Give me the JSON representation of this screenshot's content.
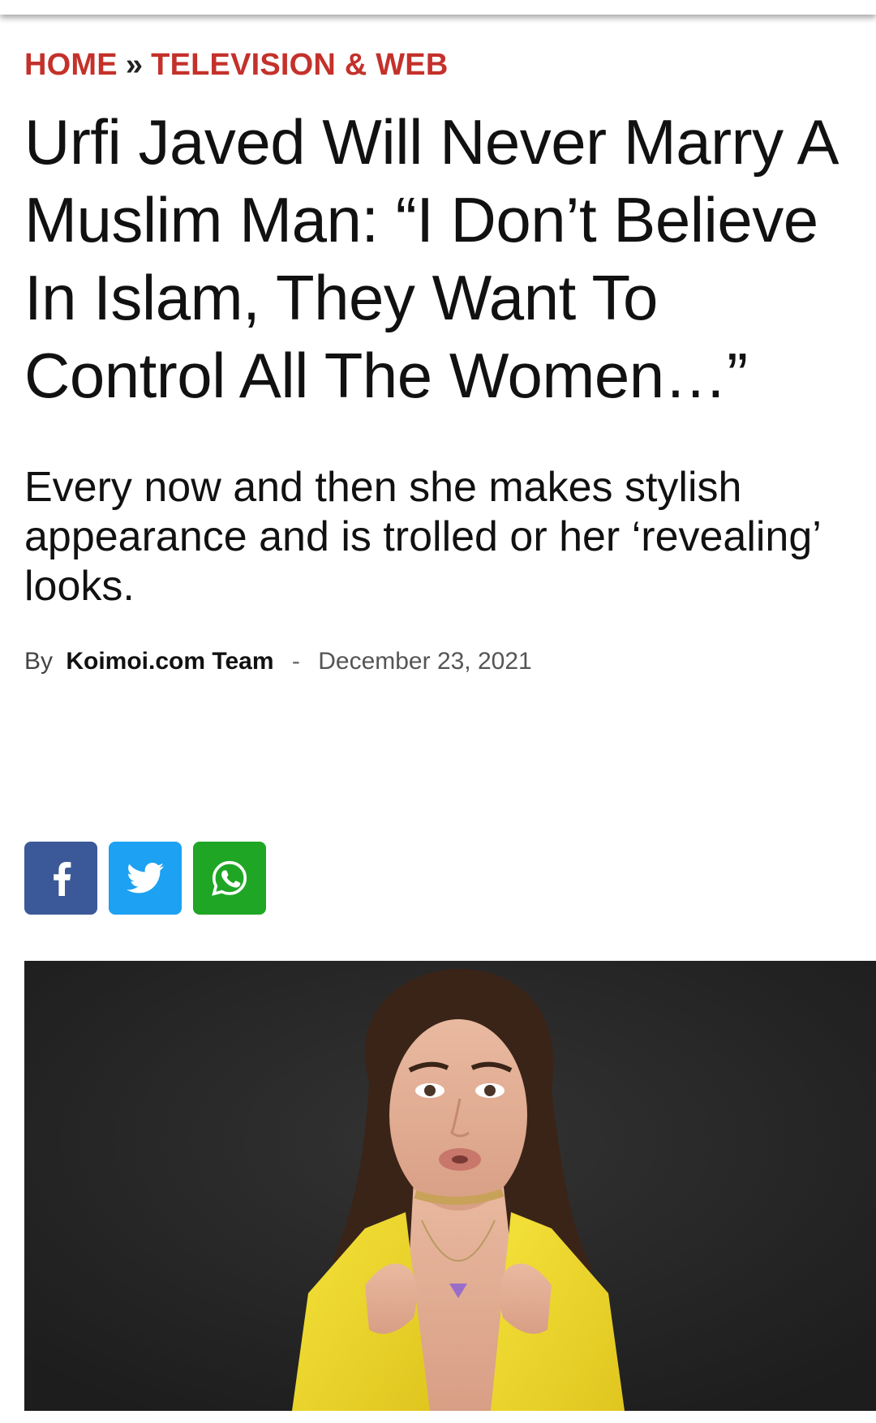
{
  "breadcrumb": {
    "home": "HOME",
    "separator": "»",
    "category": "TELEVISION & WEB"
  },
  "article": {
    "headline": "Urfi Javed Will Never Marry A Muslim Man: “I Don’t Believe In Islam, They Want To Control All The Women…”",
    "standfirst": "Every now and then she makes stylish appearance and is trolled or her ‘revealing’ looks.",
    "byline": {
      "prefix": "By",
      "author": "Koimoi.com Team",
      "separator": "-",
      "date": "December 23, 2021"
    }
  },
  "share": {
    "buttons": [
      {
        "name": "facebook",
        "icon": "facebook-icon",
        "color": "#3b5998"
      },
      {
        "name": "twitter",
        "icon": "twitter-icon",
        "color": "#1da1f2"
      },
      {
        "name": "whatsapp",
        "icon": "whatsapp-icon",
        "color": "#1fa625"
      }
    ]
  },
  "colors": {
    "accent": "#c4312b",
    "hero_background": "#262626",
    "jacket": "#f2de2c"
  }
}
